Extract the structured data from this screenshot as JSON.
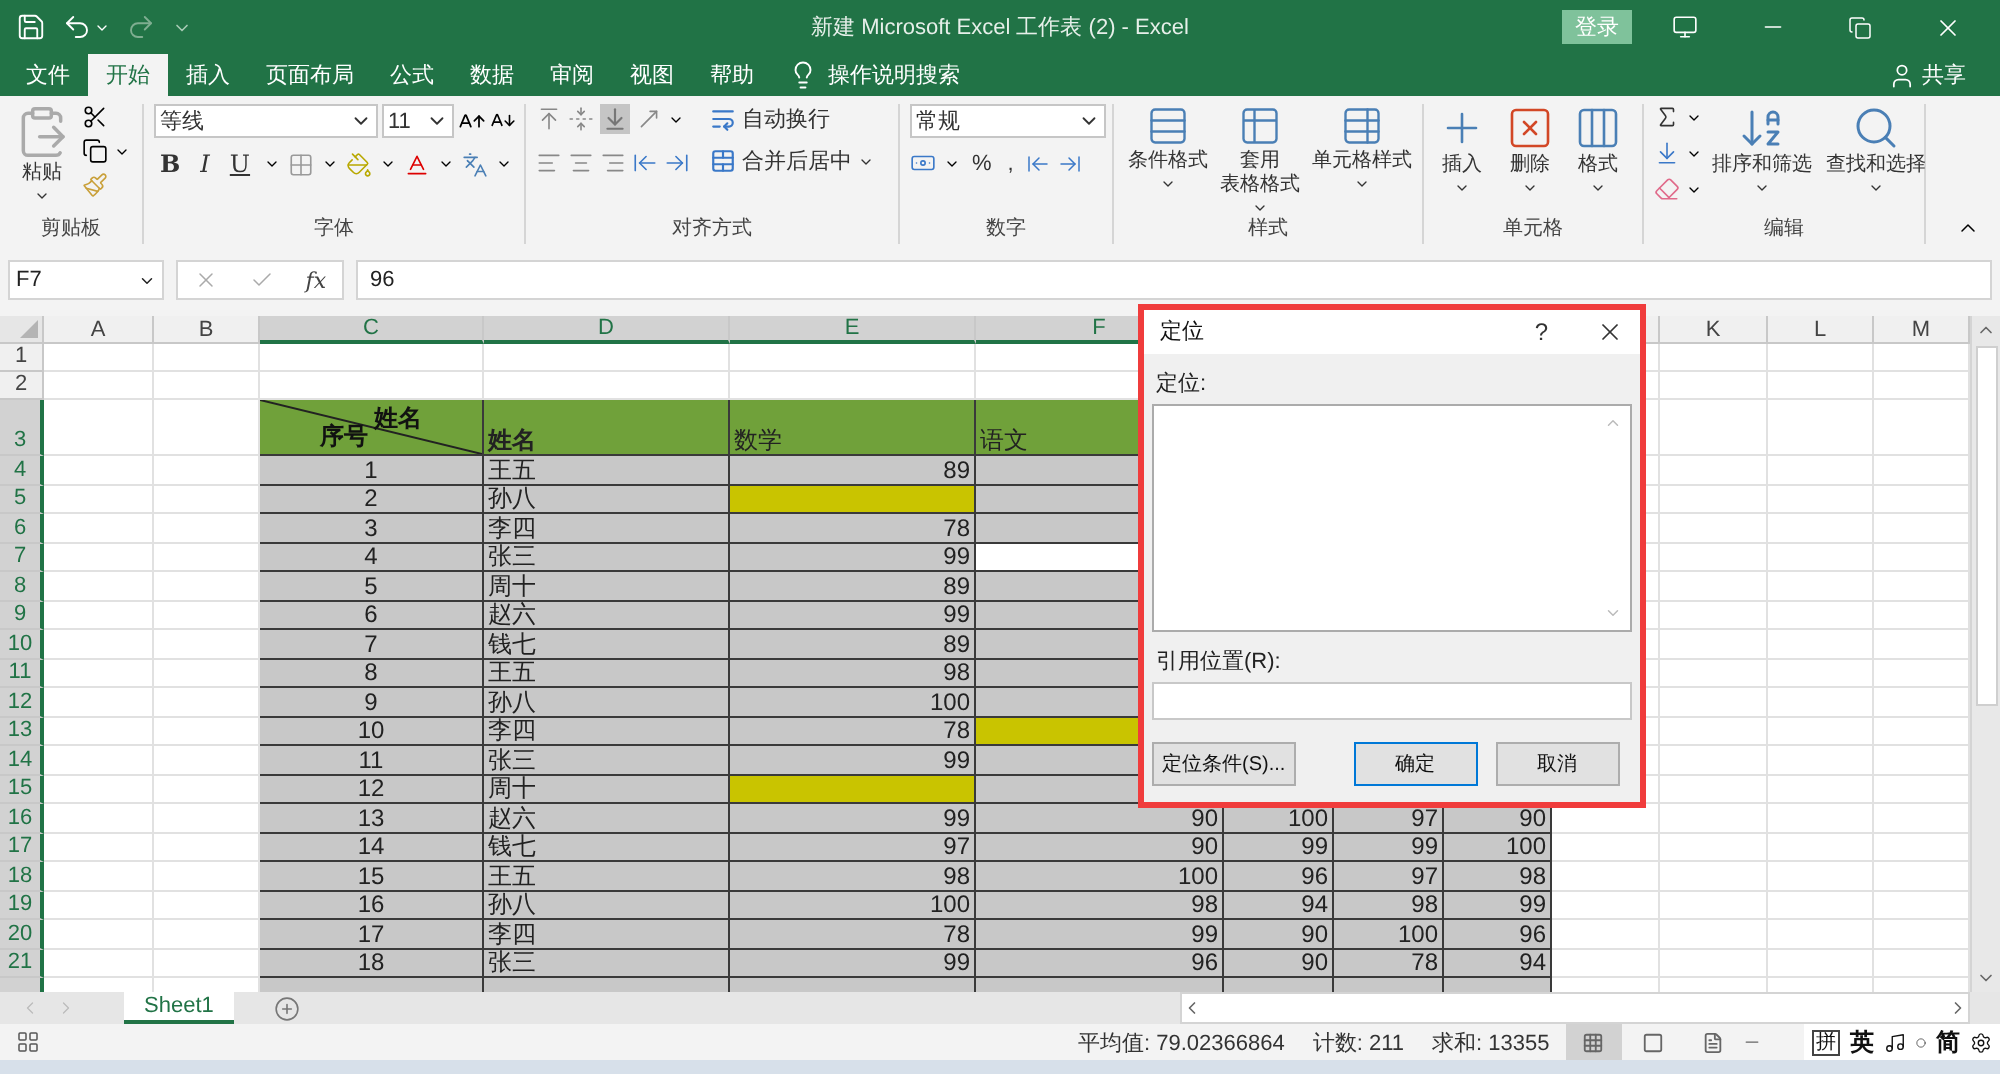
{
  "window": {
    "title": "新建 Microsoft Excel 工作表 (2)  -  Excel",
    "sign_in": "登录"
  },
  "ribbon_tabs": [
    {
      "label": "文件",
      "selected": false
    },
    {
      "label": "开始",
      "selected": true
    },
    {
      "label": "插入",
      "selected": false
    },
    {
      "label": "页面布局",
      "selected": false
    },
    {
      "label": "公式",
      "selected": false
    },
    {
      "label": "数据",
      "selected": false
    },
    {
      "label": "审阅",
      "selected": false
    },
    {
      "label": "视图",
      "selected": false
    },
    {
      "label": "帮助",
      "selected": false
    }
  ],
  "tell_me": "操作说明搜索",
  "share": "共享",
  "ribbon": {
    "clipboard": {
      "label": "剪贴板",
      "paste": "粘贴"
    },
    "font": {
      "label": "字体",
      "font_name": "等线",
      "font_size": "11",
      "bold": "B",
      "italic": "I",
      "underline": "U"
    },
    "alignment": {
      "label": "对齐方式",
      "wrap_text": "自动换行",
      "merge_center": "合并后居中"
    },
    "number": {
      "label": "数字",
      "format": "常规",
      "percent": "%",
      "comma": ","
    },
    "styles": {
      "label": "样式",
      "buttons": [
        [
          "条件格式"
        ],
        [
          "套用",
          "表格格式"
        ],
        [
          "单元格样式"
        ]
      ]
    },
    "cells": {
      "label": "单元格",
      "buttons": [
        "插入",
        "删除",
        "格式"
      ]
    },
    "editing": {
      "label": "编辑",
      "buttons": [
        "排序和筛选",
        "查找和选择"
      ]
    }
  },
  "formula_bar": {
    "name_box": "F7",
    "fx": "fx",
    "value": "96"
  },
  "sheet": {
    "columns_left": [
      {
        "label": "A",
        "selected": false
      },
      {
        "label": "B",
        "selected": false
      },
      {
        "label": "C",
        "selected": true
      },
      {
        "label": "D",
        "selected": true
      },
      {
        "label": "E",
        "selected": true
      },
      {
        "label": "F",
        "selected": true
      }
    ],
    "columns_right": [
      {
        "label": "K",
        "selected": false
      },
      {
        "label": "L",
        "selected": false
      },
      {
        "label": "M",
        "selected": false
      }
    ],
    "rows": [
      {
        "header": "1",
        "selected": false,
        "kind": "blank"
      },
      {
        "header": "2",
        "selected": false,
        "kind": "blank"
      },
      {
        "header": "3",
        "selected": true,
        "kind": "heading",
        "diagonal_top": "姓名",
        "diagonal_bottom": "序号",
        "headings": [
          "姓名",
          "数学",
          "语文"
        ]
      },
      {
        "header": "4",
        "selected": true,
        "kind": "data",
        "cells": [
          {
            "text": "1",
            "kind": "plain"
          },
          {
            "text": "王五",
            "kind": "plain"
          },
          {
            "text": "89",
            "kind": "plain"
          },
          {
            "kind": "plain"
          }
        ]
      },
      {
        "header": "5",
        "selected": true,
        "kind": "data",
        "cells": [
          {
            "text": "2",
            "kind": "plain"
          },
          {
            "text": "孙八",
            "kind": "plain"
          },
          {
            "kind": "highlighted"
          },
          {
            "kind": "plain"
          }
        ]
      },
      {
        "header": "6",
        "selected": true,
        "kind": "data",
        "cells": [
          {
            "text": "3",
            "kind": "plain"
          },
          {
            "text": "李四",
            "kind": "plain"
          },
          {
            "text": "78",
            "kind": "plain"
          },
          {
            "kind": "plain"
          }
        ]
      },
      {
        "header": "7",
        "selected": true,
        "kind": "data",
        "cells": [
          {
            "text": "4",
            "kind": "plain"
          },
          {
            "text": "张三",
            "kind": "plain"
          },
          {
            "text": "99",
            "kind": "plain"
          },
          {
            "kind": "active"
          }
        ]
      },
      {
        "header": "8",
        "selected": true,
        "kind": "data",
        "cells": [
          {
            "text": "5",
            "kind": "plain"
          },
          {
            "text": "周十",
            "kind": "plain"
          },
          {
            "text": "89",
            "kind": "plain"
          },
          {
            "kind": "plain"
          }
        ]
      },
      {
        "header": "9",
        "selected": true,
        "kind": "data",
        "cells": [
          {
            "text": "6",
            "kind": "plain"
          },
          {
            "text": "赵六",
            "kind": "plain"
          },
          {
            "text": "99",
            "kind": "plain"
          },
          {
            "kind": "plain"
          }
        ]
      },
      {
        "header": "10",
        "selected": true,
        "kind": "data",
        "cells": [
          {
            "text": "7",
            "kind": "plain"
          },
          {
            "text": "钱七",
            "kind": "plain"
          },
          {
            "text": "89",
            "kind": "plain"
          },
          {
            "kind": "plain"
          }
        ]
      },
      {
        "header": "11",
        "selected": true,
        "kind": "data",
        "cells": [
          {
            "text": "8",
            "kind": "plain"
          },
          {
            "text": "王五",
            "kind": "plain"
          },
          {
            "text": "98",
            "kind": "plain"
          },
          {
            "kind": "plain"
          }
        ]
      },
      {
        "header": "12",
        "selected": true,
        "kind": "data",
        "cells": [
          {
            "text": "9",
            "kind": "plain"
          },
          {
            "text": "孙八",
            "kind": "plain"
          },
          {
            "text": "100",
            "kind": "plain"
          },
          {
            "kind": "plain"
          }
        ]
      },
      {
        "header": "13",
        "selected": true,
        "kind": "data",
        "cells": [
          {
            "text": "10",
            "kind": "plain"
          },
          {
            "text": "李四",
            "kind": "plain"
          },
          {
            "text": "78",
            "kind": "plain"
          },
          {
            "kind": "highlighted"
          }
        ]
      },
      {
        "header": "14",
        "selected": true,
        "kind": "data",
        "cells": [
          {
            "text": "11",
            "kind": "plain"
          },
          {
            "text": "张三",
            "kind": "plain"
          },
          {
            "text": "99",
            "kind": "plain"
          },
          {
            "kind": "plain"
          }
        ]
      },
      {
        "header": "15",
        "selected": true,
        "kind": "data",
        "cells": [
          {
            "text": "12",
            "kind": "plain"
          },
          {
            "text": "周十",
            "kind": "plain"
          },
          {
            "kind": "highlighted"
          },
          {
            "kind": "plain"
          }
        ]
      },
      {
        "header": "16",
        "selected": true,
        "kind": "data",
        "cells": [
          {
            "text": "13",
            "kind": "plain"
          },
          {
            "text": "赵六",
            "kind": "plain"
          },
          {
            "text": "99",
            "kind": "plain"
          },
          {
            "text": "90",
            "kind": "plain"
          },
          {
            "text": "100",
            "kind": "plain"
          },
          {
            "text": "97",
            "kind": "plain"
          },
          {
            "text": "90",
            "kind": "plain"
          }
        ]
      },
      {
        "header": "17",
        "selected": true,
        "kind": "data",
        "cells": [
          {
            "text": "14",
            "kind": "plain"
          },
          {
            "text": "钱七",
            "kind": "plain"
          },
          {
            "text": "97",
            "kind": "plain"
          },
          {
            "text": "90",
            "kind": "plain"
          },
          {
            "text": "99",
            "kind": "plain"
          },
          {
            "text": "99",
            "kind": "plain"
          },
          {
            "text": "100",
            "kind": "plain"
          }
        ]
      },
      {
        "header": "18",
        "selected": true,
        "kind": "data",
        "cells": [
          {
            "text": "15",
            "kind": "plain"
          },
          {
            "text": "王五",
            "kind": "plain"
          },
          {
            "text": "98",
            "kind": "plain"
          },
          {
            "text": "100",
            "kind": "plain"
          },
          {
            "text": "96",
            "kind": "plain"
          },
          {
            "text": "97",
            "kind": "plain"
          },
          {
            "text": "98",
            "kind": "plain"
          }
        ]
      },
      {
        "header": "19",
        "selected": true,
        "kind": "data",
        "cells": [
          {
            "text": "16",
            "kind": "plain"
          },
          {
            "text": "孙八",
            "kind": "plain"
          },
          {
            "text": "100",
            "kind": "plain"
          },
          {
            "text": "98",
            "kind": "plain"
          },
          {
            "text": "94",
            "kind": "plain"
          },
          {
            "text": "98",
            "kind": "plain"
          },
          {
            "text": "99",
            "kind": "plain"
          }
        ]
      },
      {
        "header": "20",
        "selected": true,
        "kind": "data",
        "cells": [
          {
            "text": "17",
            "kind": "plain"
          },
          {
            "text": "李四",
            "kind": "plain"
          },
          {
            "text": "78",
            "kind": "plain"
          },
          {
            "text": "99",
            "kind": "plain"
          },
          {
            "text": "90",
            "kind": "plain"
          },
          {
            "text": "100",
            "kind": "plain"
          },
          {
            "text": "96",
            "kind": "plain"
          }
        ]
      },
      {
        "header": "21",
        "selected": true,
        "kind": "data",
        "cells": [
          {
            "text": "18",
            "kind": "plain"
          },
          {
            "text": "张三",
            "kind": "plain"
          },
          {
            "text": "99",
            "kind": "plain"
          },
          {
            "text": "96",
            "kind": "plain"
          },
          {
            "text": "90",
            "kind": "plain"
          },
          {
            "text": "78",
            "kind": "plain"
          },
          {
            "text": "94",
            "kind": "plain"
          }
        ]
      },
      {
        "selected": true,
        "kind": "cut"
      }
    ]
  },
  "sheet_tabs": [
    {
      "label": "Sheet1",
      "selected": true
    }
  ],
  "status_bar": {
    "average": "平均值: 79.02366864",
    "count": "计数: 211",
    "sum": "求和: 13355",
    "views": [
      {
        "selected": true
      },
      {
        "selected": false
      },
      {
        "selected": false
      }
    ]
  },
  "ime_bar": {
    "pinyin": "拼",
    "language": "英",
    "script": "简"
  },
  "dialog": {
    "title": "定位",
    "help": "?",
    "list_label": "定位:",
    "reference_label": "引用位置(R):",
    "buttons": [
      {
        "label": "定位条件(S)...",
        "kind": "normal"
      },
      {
        "label": "确定",
        "kind": "default"
      },
      {
        "label": "取消",
        "kind": "normal"
      }
    ]
  }
}
